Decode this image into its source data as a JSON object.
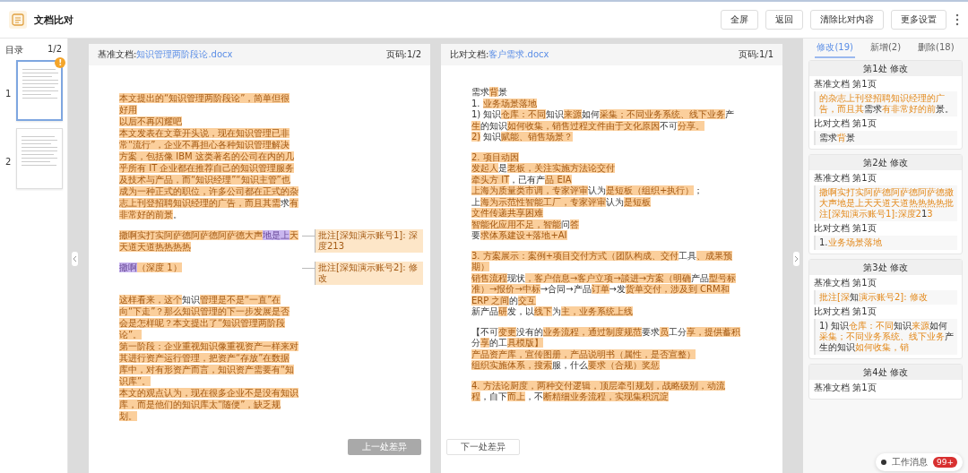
{
  "app": {
    "title": "文档比对"
  },
  "toolbar": [
    "全屏",
    "返回",
    "清除比对内容",
    "更多设置"
  ],
  "outline": {
    "label": "目录",
    "pager": "1/2",
    "pages": [
      {
        "number": "1",
        "selected": true,
        "badge": "!"
      },
      {
        "number": "2",
        "selected": false
      }
    ]
  },
  "base_doc": {
    "label": "基准文档:",
    "file": "知识管理两阶段论.docx",
    "page": "页码:1/2",
    "button": "上一处差异",
    "paragraphs": [
      {
        "segments": [
          {
            "text": "本文提出的“知识管理两阶段论”，简单但很好用",
            "kind": "changed"
          }
        ]
      },
      {
        "segments": [
          {
            "text": "以后不再闪耀吧",
            "kind": "changed"
          }
        ]
      },
      {
        "segments": [
          {
            "text": "本文发表在文章开头说，现在知识管理已非常“流行”，企业不再担心各种知识管理解决方案，包括像 IBM 这类著名的公司在内的几乎所有 IT 企业都在推荐自己的知识管理服务及技术与产品，而“知识经理”“知识主管”也成为一种正式的职位，许多公司都在正式的杂志上刊登招聘知识经理的广告，而且其需",
            "kind": "changed"
          },
          {
            "text": "求",
            "kind": "plain"
          },
          {
            "text": "有非常好的前景",
            "kind": "changed"
          },
          {
            "text": "。",
            "kind": "plain"
          }
        ]
      },
      {
        "gap": true,
        "segments": [
          {
            "text": "撒啊实打实阿萨德阿萨德阿萨德大声",
            "kind": "changed"
          },
          {
            "text": "地是上",
            "kind": "current"
          },
          {
            "text": "天天道天道热热热热",
            "kind": "changed"
          }
        ],
        "comment": "批注[深知演示账号1]: 深度213"
      },
      {
        "gap": true,
        "segments": [
          {
            "text": "撒啊",
            "kind": "current"
          },
          {
            "text": "（深度 1）",
            "kind": "changed"
          }
        ],
        "comment": "批注[深知演示账号2]: 修改"
      },
      {
        "gap": true,
        "segments": [
          {
            "text": "这样看来，这个",
            "kind": "changed"
          },
          {
            "text": "知识",
            "kind": "plain"
          },
          {
            "text": "管理是不是“一直”在向“下走”？那么知识管理的下一步发展是否会是怎样呢？本文提出了“知识管理两阶段论”。",
            "kind": "changed"
          }
        ]
      },
      {
        "segments": [
          {
            "text": "第一阶段：企业重视知识像重视资产一样来对其进行资产运行管理，把资产“存放”在数据库中，对有形资产而言，知识资产需要有“知识库”。",
            "kind": "changed"
          }
        ]
      },
      {
        "segments": [
          {
            "text": "本文的观点认为，现在很多企业不是没有知识库，而是他们的知识库太“随便”，缺乏规划。",
            "kind": "changed"
          }
        ]
      }
    ]
  },
  "compare_doc": {
    "label": "比对文档:",
    "file": "客户需求.docx",
    "page": "页码:1/1",
    "button": "下一处差异",
    "blocks": [
      {
        "lines": [
          [
            {
              "text": "需求",
              "kind": "plain"
            },
            {
              "text": "背",
              "kind": "changed"
            },
            {
              "text": "景",
              "kind": "plain"
            }
          ],
          [
            {
              "text": "1. ",
              "kind": "plain"
            },
            {
              "text": "业务场景落地",
              "kind": "changed"
            }
          ],
          [
            {
              "text": "1) 知识",
              "kind": "plain"
            },
            {
              "text": "仓库：不同",
              "kind": "changed"
            },
            {
              "text": "知识",
              "kind": "plain"
            },
            {
              "text": "来源",
              "kind": "changed"
            },
            {
              "text": "如何",
              "kind": "plain"
            },
            {
              "text": "采集；不同业务系统、线下业务",
              "kind": "changed"
            },
            {
              "text": "产",
              "kind": "plain"
            },
            {
              "text": "生",
              "kind": "changed"
            },
            {
              "text": "的知识",
              "kind": "plain"
            },
            {
              "text": "如何收集，销售过程文件由于文化原因",
              "kind": "changed"
            },
            {
              "text": "不可",
              "kind": "plain"
            },
            {
              "text": "分享。",
              "kind": "changed"
            }
          ],
          [
            {
              "text": "2)",
              "kind": "changed"
            },
            {
              "text": " 知识",
              "kind": "plain"
            },
            {
              "text": "赋能、销售场景？",
              "kind": "changed"
            }
          ]
        ]
      },
      {
        "lines": [
          [
            {
              "text": "2. 项目动因",
              "kind": "changed"
            }
          ],
          [
            {
              "text": "发起人",
              "kind": "changed"
            },
            {
              "text": "是",
              "kind": "plain"
            },
            {
              "text": "老板，关注实施方法论交付",
              "kind": "changed"
            }
          ],
          [
            {
              "text": "牵头方 IT",
              "kind": "changed"
            },
            {
              "text": "，已有产",
              "kind": "plain"
            },
            {
              "text": "品 EIA",
              "kind": "changed"
            }
          ],
          [
            {
              "text": "上海为质量类市调，专家评审",
              "kind": "changed"
            },
            {
              "text": "认为",
              "kind": "plain"
            },
            {
              "text": "是短板（组织+执行）",
              "kind": "changed"
            },
            {
              "text": "；",
              "kind": "plain"
            }
          ],
          [
            {
              "text": "上",
              "kind": "plain"
            },
            {
              "text": "海为示范性智能工厂，专家评审",
              "kind": "changed"
            },
            {
              "text": "认为",
              "kind": "plain"
            },
            {
              "text": "是短板",
              "kind": "changed"
            }
          ],
          [
            {
              "text": "文件传递共享困难",
              "kind": "changed"
            }
          ],
          [
            {
              "text": "智能化应用不足，智能",
              "kind": "changed"
            },
            {
              "text": "问",
              "kind": "plain"
            },
            {
              "text": "答",
              "kind": "changed"
            }
          ],
          [
            {
              "text": "要",
              "kind": "plain"
            },
            {
              "text": "求体系建设+落地+AI",
              "kind": "changed"
            }
          ]
        ]
      },
      {
        "lines": [
          [
            {
              "text": "3. 方案展示：案例+项目交付方式（团队构成、交付",
              "kind": "changed"
            },
            {
              "text": "工具",
              "kind": "plain"
            },
            {
              "text": "、成果预期）",
              "kind": "changed"
            }
          ],
          [
            {
              "text": "销售流程",
              "kind": "changed"
            },
            {
              "text": "现状",
              "kind": "plain"
            },
            {
              "text": "，客户信息→客户立项→談进→方案（明确",
              "kind": "changed"
            },
            {
              "text": "产品",
              "kind": "plain"
            },
            {
              "text": "型号标准）→报价→中标",
              "kind": "changed"
            },
            {
              "text": "→合同→产品",
              "kind": "plain"
            },
            {
              "text": "订单",
              "kind": "changed"
            },
            {
              "text": "→发",
              "kind": "plain"
            },
            {
              "text": "货单交付，涉及到 CRM和ERP 之间",
              "kind": "changed"
            },
            {
              "text": "的",
              "kind": "plain"
            },
            {
              "text": "交互",
              "kind": "changed"
            }
          ],
          [
            {
              "text": "新产品",
              "kind": "plain"
            },
            {
              "text": "研",
              "kind": "changed"
            },
            {
              "text": "发，以",
              "kind": "plain"
            },
            {
              "text": "线下",
              "kind": "changed"
            },
            {
              "text": "为",
              "kind": "plain"
            },
            {
              "text": "主，业务系统上线",
              "kind": "changed"
            }
          ]
        ]
      },
      {
        "lines": [
          [
            {
              "text": "【不可",
              "kind": "plain"
            },
            {
              "text": "变更",
              "kind": "changed"
            },
            {
              "text": "没有的",
              "kind": "plain"
            },
            {
              "text": "业务流程，通过制度规范",
              "kind": "changed"
            },
            {
              "text": "要求",
              "kind": "plain"
            },
            {
              "text": "员",
              "kind": "changed"
            },
            {
              "text": "工分",
              "kind": "plain"
            },
            {
              "text": "享，提供蓄积",
              "kind": "changed"
            },
            {
              "text": "分",
              "kind": "plain"
            },
            {
              "text": "享",
              "kind": "changed"
            },
            {
              "text": "的工",
              "kind": "plain"
            },
            {
              "text": "具模版】",
              "kind": "changed"
            }
          ],
          [
            {
              "text": "产品资产库，宣传图册，产品说明书（属性，是否宣整）",
              "kind": "changed"
            }
          ],
          [
            {
              "text": "组织实施体系，搜索",
              "kind": "changed"
            },
            {
              "text": "服，什么",
              "kind": "plain"
            },
            {
              "text": "要求（合规）奖惩",
              "kind": "changed"
            }
          ]
        ]
      },
      {
        "lines": [
          [
            {
              "text": "4. 方法论厨度，两种交付逻辑，顶层牵引规划，战略级别，动流程",
              "kind": "changed"
            },
            {
              "text": "，自下",
              "kind": "plain"
            },
            {
              "text": "而上",
              "kind": "changed"
            },
            {
              "text": "，不",
              "kind": "plain"
            },
            {
              "text": "断精细业务流程，实现集积沉淀",
              "kind": "changed"
            }
          ]
        ]
      }
    ]
  },
  "diff_tabs": [
    {
      "label": "修改(19)",
      "selected": true
    },
    {
      "label": "新增(2)",
      "selected": false
    },
    {
      "label": "删除(18)",
      "selected": false
    }
  ],
  "diff_cards": [
    {
      "title": "第1处 修改",
      "base_label": "基准文档 第1页",
      "base_text": [
        {
          "text": "的杂志上刊登招聘知识经理的广告，而且其",
          "kind": "changed"
        },
        {
          "text": "需求",
          "kind": "plain"
        },
        {
          "text": "有非常好的前",
          "kind": "changed"
        },
        {
          "text": "景。",
          "kind": "plain"
        }
      ],
      "compare_label": "比对文档 第1页",
      "compare_text": [
        {
          "text": "需求",
          "kind": "plain"
        },
        {
          "text": "背",
          "kind": "changed"
        },
        {
          "text": "景",
          "kind": "plain"
        }
      ]
    },
    {
      "title": "第2处 修改",
      "base_label": "基准文档 第1页",
      "base_text": [
        {
          "text": "撒啊实打实阿萨德阿萨德阿萨德撒大声地是上天天道天道热热热热批注[深知演示账号1]:深度2",
          "kind": "changed"
        },
        {
          "text": "1",
          "kind": "plain"
        },
        {
          "text": "3",
          "kind": "changed"
        }
      ],
      "compare_label": "比对文档 第1页",
      "compare_text": [
        {
          "text": "1.",
          "kind": "plain"
        },
        {
          "text": "业务场景落地",
          "kind": "changed"
        }
      ]
    },
    {
      "title": "第3处 修改",
      "base_label": "基准文档 第1页",
      "base_text": [
        {
          "text": "批注[深",
          "kind": "changed"
        },
        {
          "text": "知",
          "kind": "plain"
        },
        {
          "text": "演示账号2]: 修改",
          "kind": "changed"
        }
      ],
      "compare_label": "比对文档 第1页",
      "compare_text": [
        {
          "text": "1) 知识",
          "kind": "plain"
        },
        {
          "text": "仓库：不同",
          "kind": "changed"
        },
        {
          "text": "知识",
          "kind": "plain"
        },
        {
          "text": "来源",
          "kind": "changed"
        },
        {
          "text": "如何",
          "kind": "plain"
        },
        {
          "text": "采集；不同业务系统、线下业务",
          "kind": "changed"
        },
        {
          "text": "产生",
          "kind": "plain"
        },
        {
          "text": "的知识",
          "kind": "plain"
        },
        {
          "text": "如何收集，销",
          "kind": "changed"
        }
      ]
    },
    {
      "title": "第4处 修改",
      "base_label": "基准文档 第1页"
    }
  ],
  "messages": {
    "label": "工作消息",
    "count": "99+"
  }
}
